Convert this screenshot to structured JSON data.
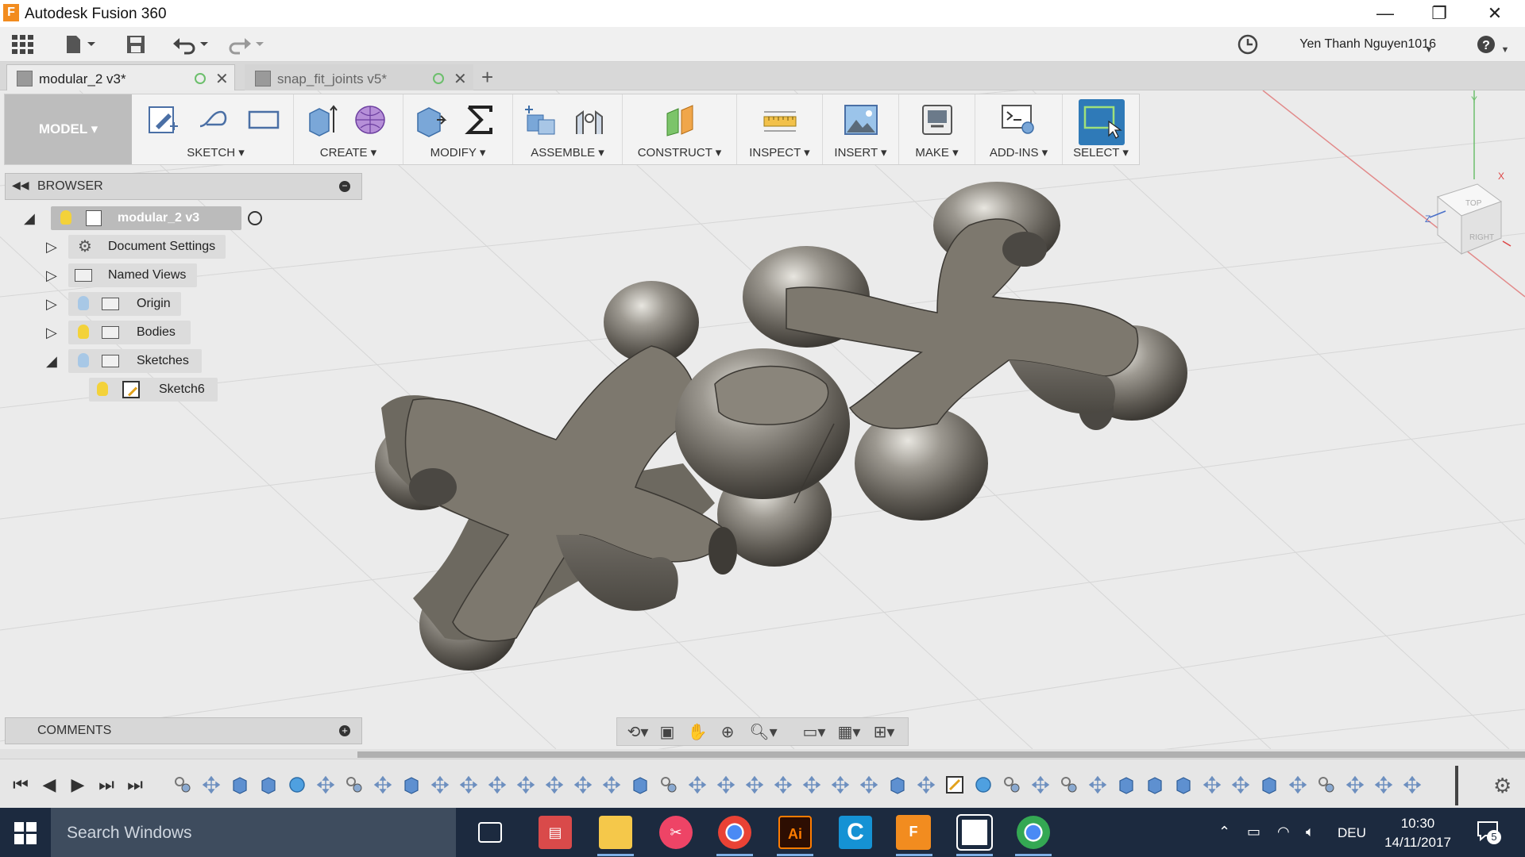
{
  "window": {
    "title": "Autodesk Fusion 360",
    "app_icon": "F",
    "accent": "#f28c1f"
  },
  "quick_access": {
    "user": "Yen Thanh Nguyen1016",
    "help": "?"
  },
  "tabs": [
    {
      "label": "modular_2 v3*",
      "active": true
    },
    {
      "label": "snap_fit_joints v5*",
      "active": false
    }
  ],
  "toolbar": {
    "mode": "MODEL",
    "groups": [
      "SKETCH",
      "CREATE",
      "MODIFY",
      "ASSEMBLE",
      "CONSTRUCT",
      "INSPECT",
      "INSERT",
      "MAKE",
      "ADD-INS",
      "SELECT"
    ],
    "select_color": "#2f7ab8"
  },
  "browser": {
    "header": "BROWSER",
    "root": "modular_2 v3",
    "items": [
      {
        "label": "Document Settings",
        "icon": "gear-icon"
      },
      {
        "label": "Named Views",
        "icon": "folder-icon"
      },
      {
        "label": "Origin",
        "icon": "folder-icon"
      },
      {
        "label": "Bodies",
        "icon": "folder-icon"
      },
      {
        "label": "Sketches",
        "icon": "folder-icon"
      },
      {
        "label": "Sketch6",
        "icon": "sketch-icon"
      }
    ]
  },
  "viewcube": {
    "top": "TOP",
    "right": "RIGHT",
    "axis_z": "Z",
    "axis_y": "Y",
    "axis_x": "X"
  },
  "comments": {
    "header": "COMMENTS"
  },
  "taskbar": {
    "search_placeholder": "Search Windows",
    "language": "DEU",
    "time": "10:30",
    "date": "14/11/2017",
    "notifications": "5",
    "apps": [
      "task-view",
      "cocktail",
      "file-explorer",
      "paint-tool",
      "chrome",
      "illustrator",
      "ccleaner",
      "fusion-360",
      "app-box",
      "chrome"
    ]
  }
}
